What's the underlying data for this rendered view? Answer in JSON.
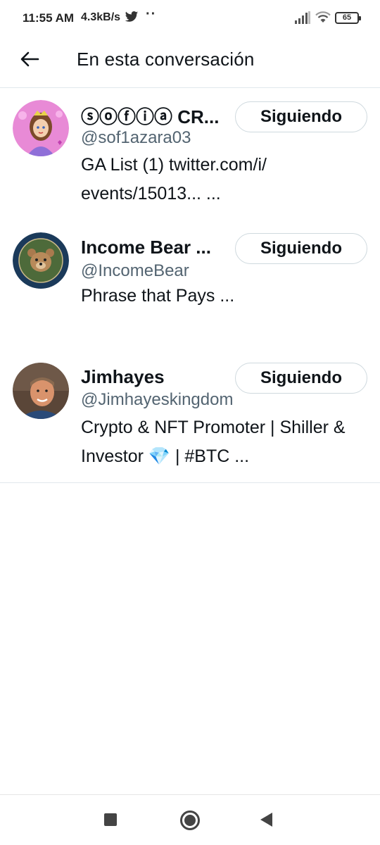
{
  "status_bar": {
    "time": "11:55 AM",
    "speed": "4.3kB/s",
    "dots": "··",
    "battery": "65",
    "icons": [
      "twitter-bird-icon",
      "signal-icon",
      "wifi-icon",
      "battery-icon"
    ]
  },
  "header": {
    "title": "En esta conversación",
    "back_icon": "arrow-left-icon"
  },
  "users": [
    {
      "name": "ⓢⓞⓕⓘⓐ CR...",
      "handle": "@sof1azara03",
      "bio": "GA List (1) twitter.com/i/ events/15013... ...",
      "follow_label": "Siguiendo"
    },
    {
      "name": "Income Bear ...",
      "handle": "@IncomeBear",
      "bio": "Phrase that Pays ...",
      "follow_label": "Siguiendo"
    },
    {
      "name": "Jimhayes",
      "handle": "@Jimhayeskingdom",
      "bio": "Crypto & NFT Promoter | Shiller & Investor 💎 | #BTC ...",
      "follow_label": "Siguiendo"
    }
  ],
  "nav_bar": {
    "icons": [
      "recent-apps-icon",
      "home-icon",
      "back-icon"
    ]
  },
  "colors": {
    "text_primary": "#0f1419",
    "text_secondary": "#536471",
    "divider": "#e1e8ed",
    "button_border": "#cfd9de"
  }
}
